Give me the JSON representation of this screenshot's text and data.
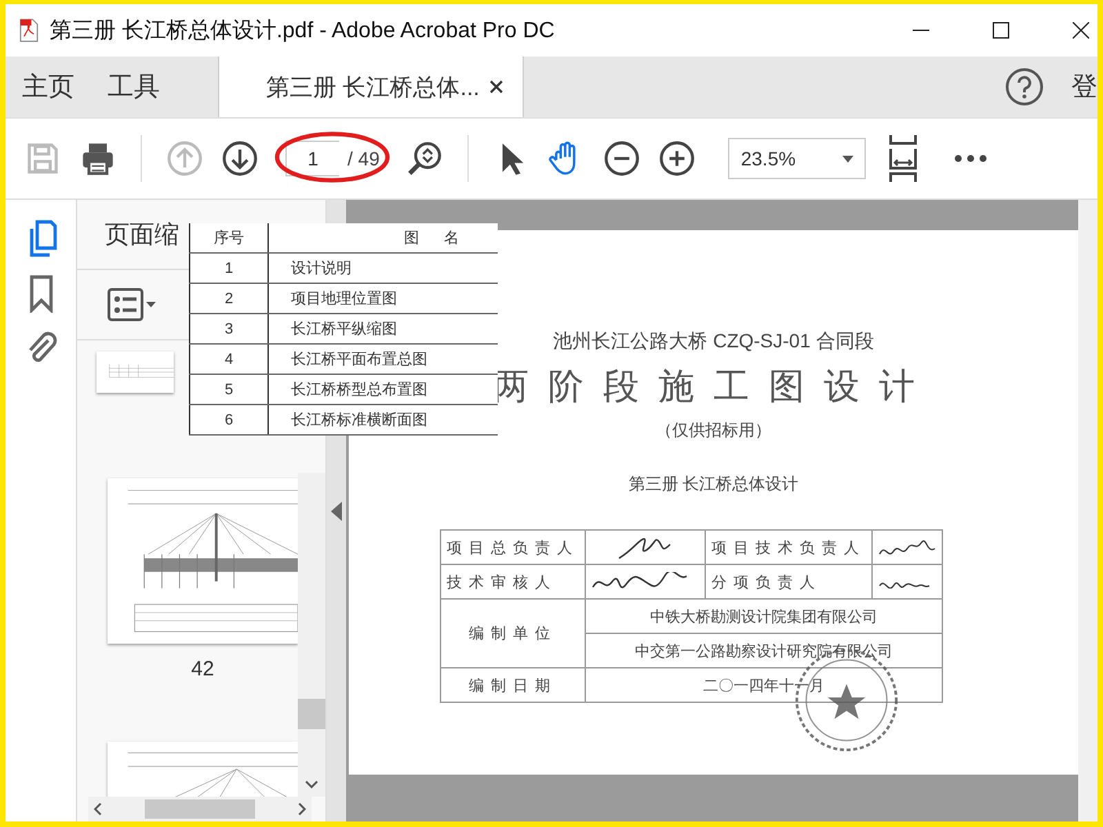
{
  "window": {
    "title": "第三册 长江桥总体设计.pdf - Adobe Acrobat Pro DC"
  },
  "tabs": [
    {
      "label": "主页",
      "selected": false,
      "closable": false
    },
    {
      "label": "工具",
      "selected": false,
      "closable": false
    },
    {
      "label": "第三册 长江桥总体...",
      "selected": true,
      "closable": true
    }
  ],
  "account": {
    "label": "登"
  },
  "toolbar": {
    "page": "1",
    "page_total": "/ 49",
    "zoom": "23.5%"
  },
  "sidebar": {
    "title": "页面缩",
    "tools": [
      {
        "kind": "pages",
        "selected": true
      },
      {
        "kind": "bookmark",
        "selected": false
      },
      {
        "kind": "attachment",
        "selected": false
      }
    ],
    "thumbnail_label": "42"
  },
  "document": {
    "subtitle": "池州长江公路大桥 CZQ-SJ-01 合同段",
    "title": "两阶段施工图设计",
    "note": "（仅供招标用）",
    "volume": "第三册 长江桥总体设计",
    "sign_rows": [
      {
        "label": "项目总负责人",
        "label2": "项目技术负责人"
      },
      {
        "label": "技术审核人",
        "label2": "分项负责人"
      }
    ],
    "org_label": "编制单位",
    "orgs": [
      "中铁大桥勘测设计院集团有限公司",
      "中交第一公路勘察设计研究院有限公司"
    ],
    "date_label": "编制日期",
    "date": "二〇一四年十一月"
  },
  "overlay_table": {
    "columns": [
      "序号",
      "图名"
    ],
    "rows": [
      [
        "1",
        "设计说明"
      ],
      [
        "2",
        "项目地理位置图"
      ],
      [
        "3",
        "长江桥平纵缩图"
      ],
      [
        "4",
        "长江桥平面布置总图"
      ],
      [
        "5",
        "长江桥桥型总布置图"
      ],
      [
        "6",
        "长江桥标准横断面图"
      ]
    ]
  }
}
